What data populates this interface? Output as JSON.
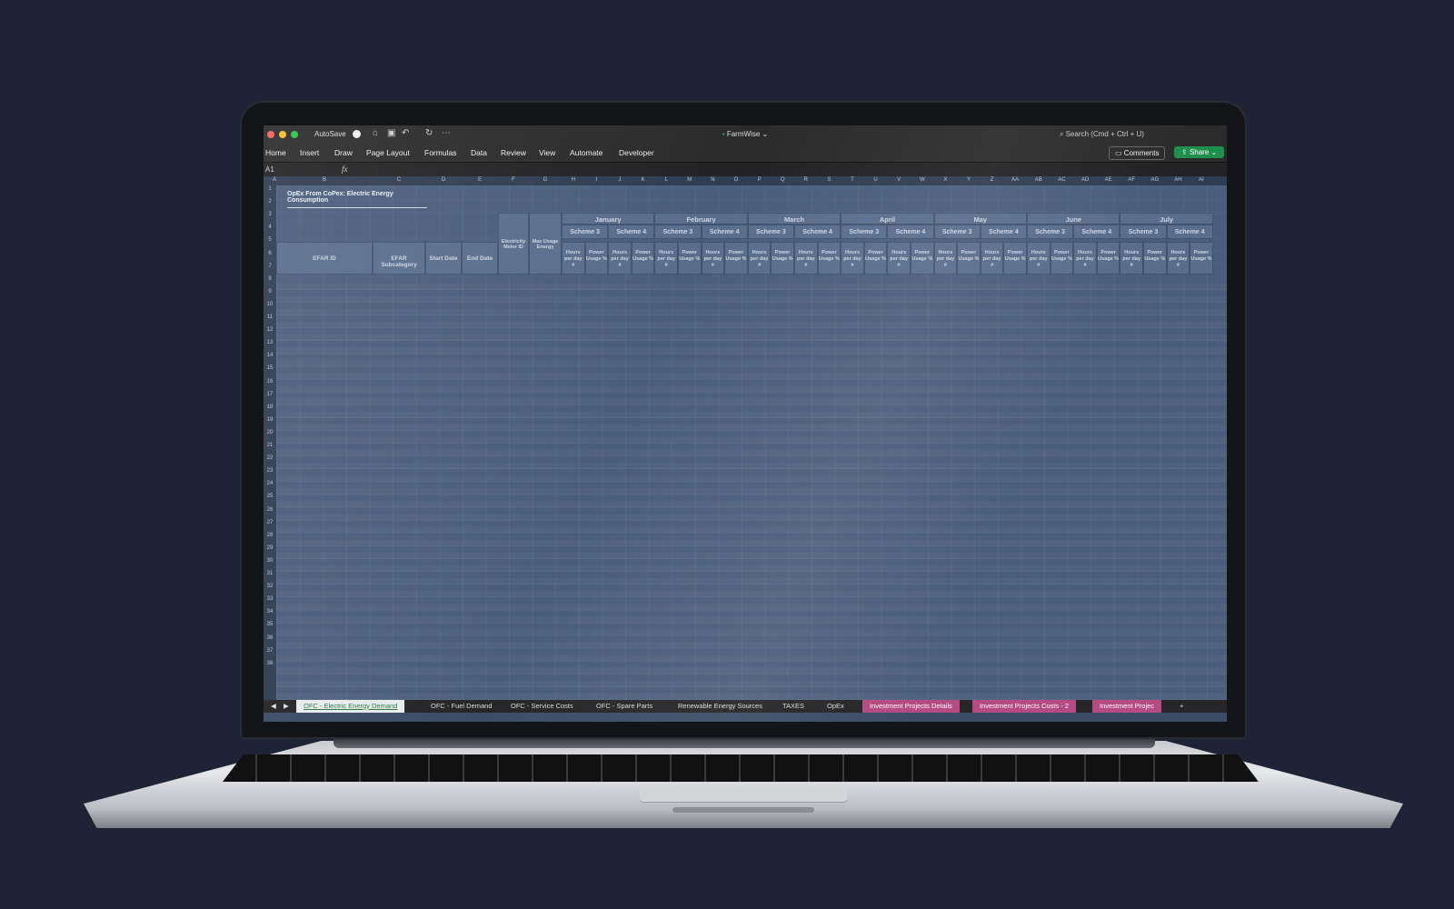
{
  "window": {
    "autosave_label": "AutoSave",
    "doc_title": "FarmWise",
    "search_placeholder": "Search (Cmd + Ctrl + U)"
  },
  "ribbon": {
    "tabs": [
      "Home",
      "Insert",
      "Draw",
      "Page Layout",
      "Formulas",
      "Data",
      "Review",
      "View",
      "Automate",
      "Developer"
    ],
    "comments_label": "Comments",
    "share_label": "Share"
  },
  "formula_bar": {
    "name_box": "A1",
    "fx": "fx"
  },
  "columns": [
    "A",
    "B",
    "C",
    "D",
    "E",
    "F",
    "G",
    "H",
    "I",
    "J",
    "K",
    "L",
    "M",
    "N",
    "O",
    "P",
    "Q",
    "R",
    "S",
    "T",
    "U",
    "V",
    "W",
    "X",
    "Y",
    "Z",
    "AA",
    "AB",
    "AC",
    "AD",
    "AE",
    "AF",
    "AG",
    "AH",
    "AI"
  ],
  "rows": [
    "1",
    "2",
    "3",
    "4",
    "5",
    "6",
    "7",
    "8",
    "9",
    "10",
    "11",
    "12",
    "13",
    "14",
    "15",
    "16",
    "17",
    "18",
    "19",
    "20",
    "21",
    "22",
    "23",
    "24",
    "25",
    "26",
    "27",
    "28",
    "29",
    "30",
    "31",
    "32",
    "33",
    "34",
    "35",
    "36",
    "37",
    "38"
  ],
  "sheet": {
    "title": "OpEx From CoPex: Electric Energy Consumption",
    "headers": {
      "efar_id": "EFAR ID",
      "efar_subcategory": "EFAR Subcategory",
      "start_date": "Start Date",
      "end_date": "End Date",
      "meter_id": "Electricity Meter ID",
      "max_usage": "Max Usage Energy"
    },
    "months": [
      "January",
      "February",
      "March",
      "April",
      "May",
      "June",
      "July"
    ],
    "schemes": [
      "Scheme 3",
      "Scheme 4"
    ],
    "sub_labels": [
      "Hours per day #",
      "Power Usage %"
    ]
  },
  "sheet_tabs": [
    {
      "label": "OFC - Electric Energy Demand",
      "style": "active"
    },
    {
      "label": "OFC - Fuel Demand",
      "style": "normal"
    },
    {
      "label": "OFC - Service Costs",
      "style": "normal"
    },
    {
      "label": "OFC - Spare Parts",
      "style": "normal"
    },
    {
      "label": "Renewable Energy Sources",
      "style": "normal"
    },
    {
      "label": "TAXES",
      "style": "normal"
    },
    {
      "label": "OpEx",
      "style": "normal"
    },
    {
      "label": "Investment Projects Details",
      "style": "pink"
    },
    {
      "label": "Investment Projects Costs - 2",
      "style": "pink"
    },
    {
      "label": "Investment Projec",
      "style": "pink"
    }
  ],
  "colors": {
    "background": "#1e2336",
    "grid": "#4a5d7a",
    "share": "#1f8f4e",
    "pink_tab": "#b64a82"
  }
}
